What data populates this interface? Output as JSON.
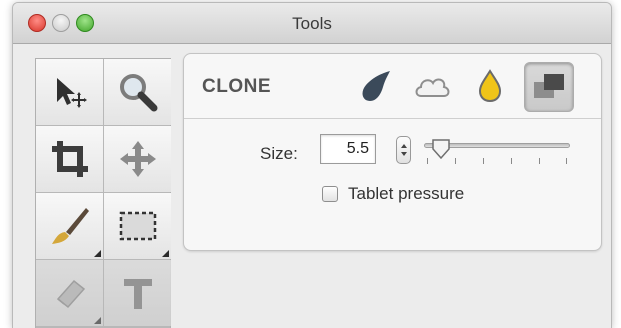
{
  "window": {
    "title": "Tools"
  },
  "tools": [
    {
      "name": "select-move-tool",
      "icon": "arrow-move-icon",
      "has_submenu": false
    },
    {
      "name": "zoom-tool",
      "icon": "magnifier-icon",
      "has_submenu": false
    },
    {
      "name": "crop-tool",
      "icon": "crop-icon",
      "has_submenu": false
    },
    {
      "name": "pan-tool",
      "icon": "move-cross-icon",
      "has_submenu": false
    },
    {
      "name": "brush-tool",
      "icon": "brush-icon",
      "has_submenu": true
    },
    {
      "name": "rect-select-tool",
      "icon": "marquee-icon",
      "has_submenu": true
    },
    {
      "name": "eraser-tool",
      "icon": "eraser-icon",
      "has_submenu": true
    },
    {
      "name": "text-tool",
      "icon": "text-icon",
      "has_submenu": false
    }
  ],
  "options_panel": {
    "mode_label": "CLONE",
    "modes": [
      {
        "name": "smudge-mode",
        "icon": "comet-icon",
        "active": false
      },
      {
        "name": "blur-mode",
        "icon": "cloud-icon",
        "active": false
      },
      {
        "name": "sharpen-mode",
        "icon": "drop-icon",
        "active": false
      },
      {
        "name": "clone-mode",
        "icon": "stamp-clone-icon",
        "active": true
      }
    ],
    "size": {
      "label": "Size:",
      "value": "5.5",
      "slider_fraction": 0.05
    },
    "tablet_pressure": {
      "label": "Tablet pressure",
      "checked": false
    }
  },
  "colors": {
    "accent": "#f0c419",
    "close": "#e0443a",
    "zoom": "#4fb337"
  }
}
